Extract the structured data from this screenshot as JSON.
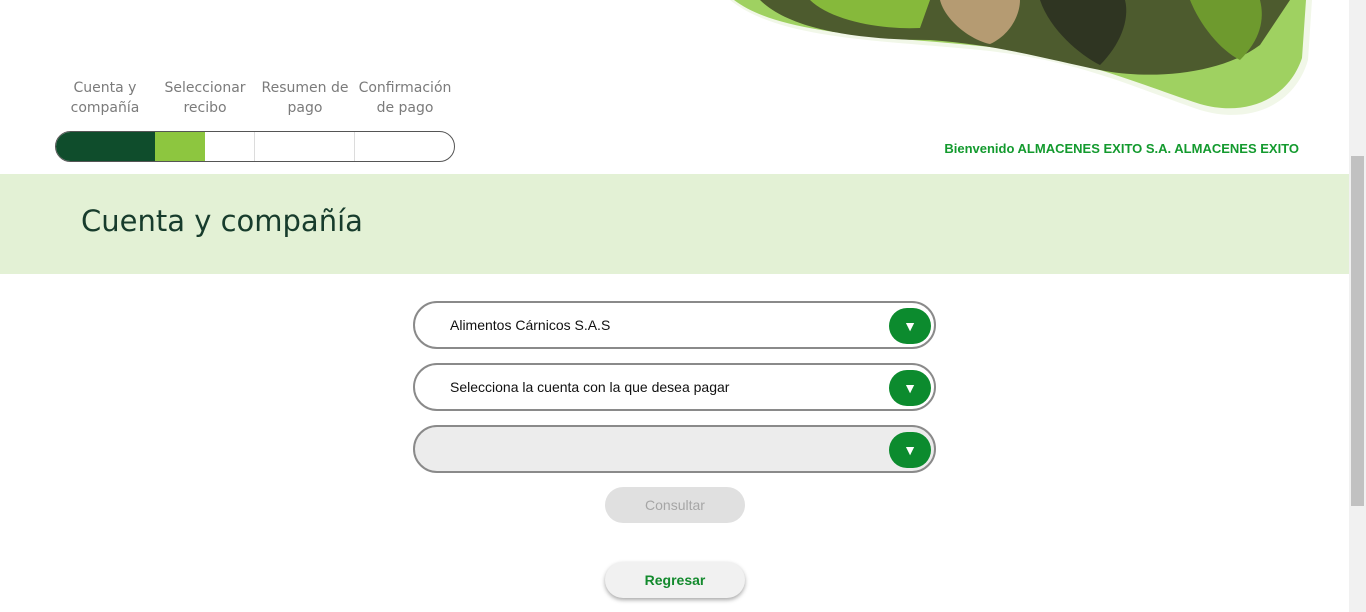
{
  "steps": [
    {
      "line1": "Cuenta y",
      "line2": "compañía"
    },
    {
      "line1": "Seleccionar",
      "line2": "recibo"
    },
    {
      "line1": "Resumen de",
      "line2": "pago"
    },
    {
      "line1": "Confirmación",
      "line2": "de pago"
    }
  ],
  "progress": {
    "completed_steps": 1,
    "current_step_fraction": 0.5
  },
  "welcome_text": "Bienvenido ALMACENES EXITO S.A. ALMACENES EXITO",
  "banner_title": "Cuenta y compañía",
  "form": {
    "company_select": {
      "value": "Alimentos Cárnicos S.A.S",
      "arrow": "▼"
    },
    "account_select": {
      "value": "Selecciona la cuenta con la que desea pagar",
      "arrow": "▼"
    },
    "third_select": {
      "value": "",
      "arrow": "▼"
    },
    "consultar_label": "Consultar",
    "regresar_label": "Regresar"
  },
  "colors": {
    "brand_dark": "#0f4d2c",
    "brand_light": "#8dc63f",
    "accent_green": "#0c8b2e",
    "banner_bg": "#e3f1d5"
  }
}
